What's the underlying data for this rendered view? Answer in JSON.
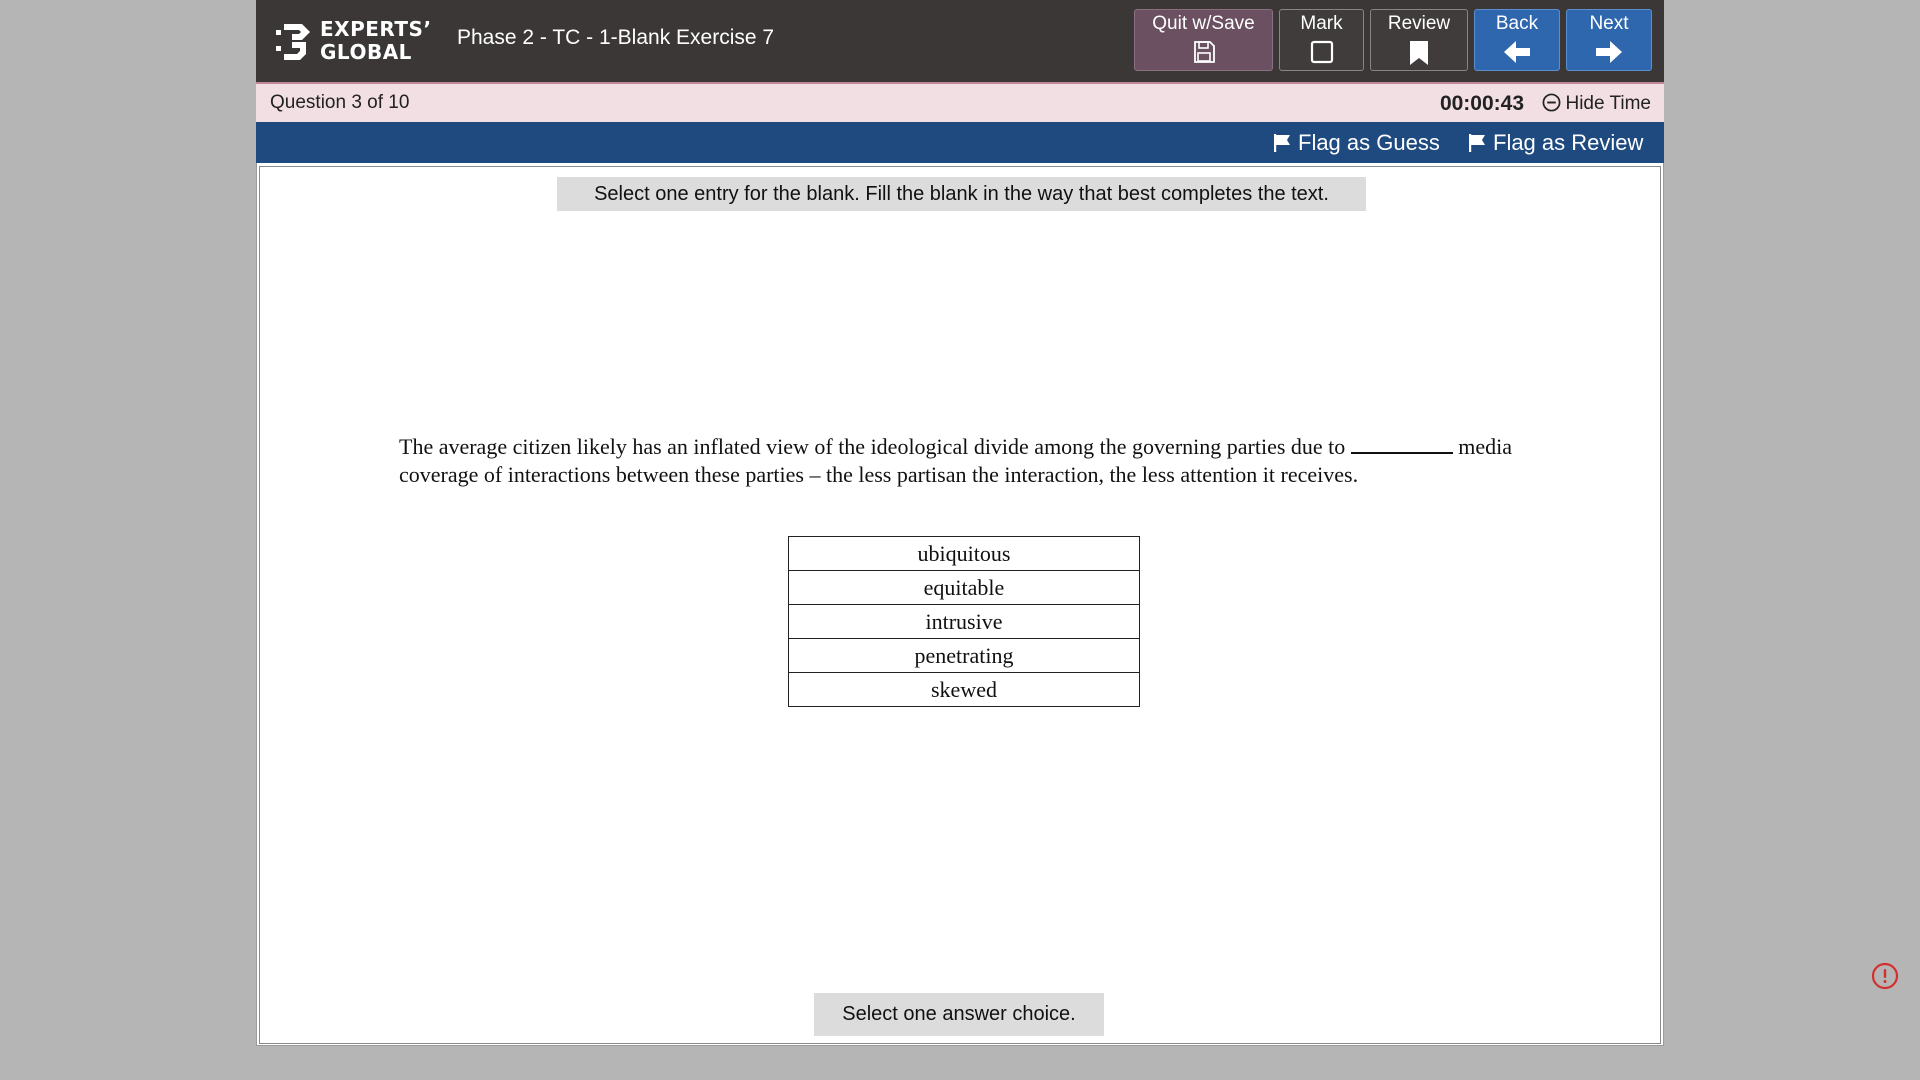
{
  "header": {
    "brand_line1": "EXPERTS’",
    "brand_line2": "GLOBAL",
    "exam_title": "Phase 2 - TC - 1-Blank Exercise 7",
    "buttons": {
      "quit_label": "Quit w/Save",
      "mark_label": "Mark",
      "review_label": "Review",
      "back_label": "Back",
      "next_label": "Next"
    }
  },
  "question_bar": {
    "counter": "Question 3 of 10",
    "timer": "00:00:43",
    "hide_time_label": "Hide Time"
  },
  "flag_bar": {
    "flag_guess_label": "Flag as Guess",
    "flag_review_label": "Flag as Review"
  },
  "content": {
    "instruction": "Select one entry for the blank. Fill the blank in the way that best completes the text.",
    "passage_before": "The average citizen likely has an inflated view of the ideological divide among the governing parties due to ",
    "passage_after": " media coverage of interactions between these parties – the less partisan the interaction, the less attention it receives.",
    "choices": [
      "ubiquitous",
      "equitable",
      "intrusive",
      "penetrating",
      "skewed"
    ],
    "footer_message": "Select one answer choice."
  },
  "colors": {
    "header_bg": "#3b3737",
    "question_bar_bg": "#f2dfe4",
    "flag_bar_bg": "#1e4a80",
    "nav_blue": "#2e67ad",
    "quit_bg": "#6a5060",
    "alert_red": "#d32f2f"
  },
  "icons": {
    "quit": "floppy-disk-icon",
    "mark": "checkbox-icon",
    "review": "bookmark-icon",
    "back": "arrow-left-icon",
    "next": "arrow-right-icon",
    "hide_time": "minus-circle-icon",
    "flag": "flag-icon",
    "alert": "exclamation-circle-icon"
  }
}
